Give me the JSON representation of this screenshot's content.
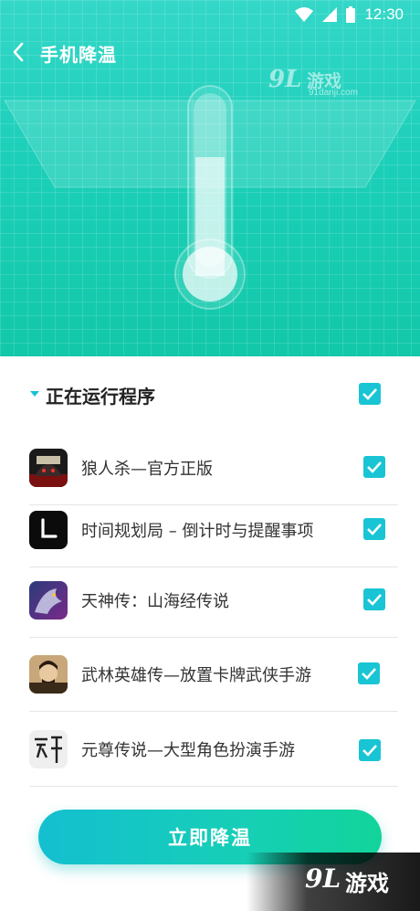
{
  "status_bar": {
    "time": "12:30"
  },
  "header": {
    "title": "手机降温"
  },
  "watermark_top": {
    "brand": "9L",
    "name": "游戏",
    "url": "91danji.com"
  },
  "section": {
    "title": "正在运行程序",
    "select_all_checked": true
  },
  "apps": [
    {
      "name": "狼人杀—官方正版",
      "icon": "werewolf-game-icon",
      "checked": true
    },
    {
      "name": "时间规划局 – 倒计时与提醒事项",
      "icon": "clock-app-icon",
      "checked": true
    },
    {
      "name": "天神传：山海经传说",
      "icon": "dragon-game-icon",
      "checked": true
    },
    {
      "name": "武林英雄传—放置卡牌武侠手游",
      "icon": "warrior-game-icon",
      "checked": true
    },
    {
      "name": "元尊传说—大型角色扮演手游",
      "icon": "calligraphy-game-icon",
      "checked": true
    }
  ],
  "action_button": {
    "label": "立即降温"
  },
  "watermark_bottom": {
    "brand": "9L",
    "name": "游戏"
  },
  "colors": {
    "accent": "#19c5d4",
    "hero_start": "#34d7c8",
    "hero_end": "#12c8a8",
    "button_end": "#12d49a"
  }
}
